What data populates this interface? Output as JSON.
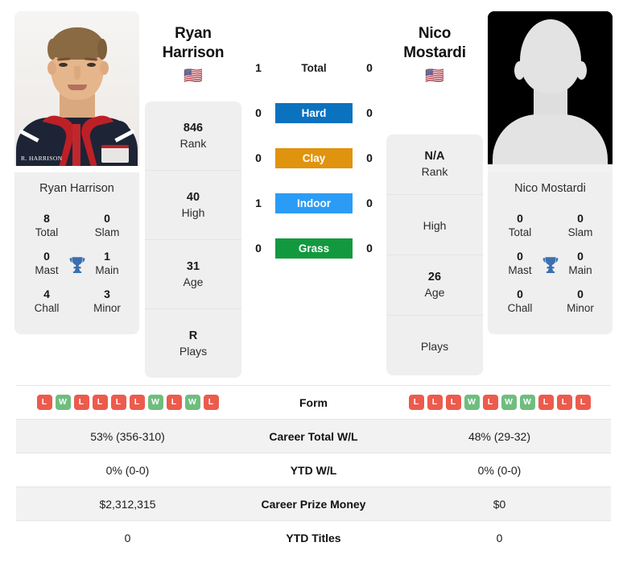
{
  "players": {
    "left": {
      "first_name": "Ryan",
      "last_name": "Harrison",
      "full_name": "Ryan Harrison",
      "flag": "🇺🇸",
      "flag_name": "usa-flag",
      "photo_jacket_text": "R. HARRISON",
      "info": [
        {
          "value": "846",
          "label": "Rank"
        },
        {
          "value": "40",
          "label": "High"
        },
        {
          "value": "31",
          "label": "Age"
        },
        {
          "value": "R",
          "label": "Plays"
        }
      ],
      "titles": [
        {
          "value": "8",
          "label": "Total"
        },
        {
          "value": "0",
          "label": "Slam"
        },
        {
          "value": "0",
          "label": "Mast"
        },
        {
          "value": "1",
          "label": "Main"
        },
        {
          "value": "4",
          "label": "Chall"
        },
        {
          "value": "3",
          "label": "Minor"
        }
      ],
      "form": [
        "L",
        "W",
        "L",
        "L",
        "L",
        "L",
        "W",
        "L",
        "W",
        "L"
      ],
      "career_total_wl": "53% (356-310)",
      "ytd_wl": "0% (0-0)",
      "career_prize_money": "$2,312,315",
      "ytd_titles": "0"
    },
    "right": {
      "first_name": "Nico",
      "last_name": "Mostardi",
      "full_name": "Nico Mostardi",
      "flag": "🇺🇸",
      "flag_name": "usa-flag",
      "info": [
        {
          "value": "N/A",
          "label": "Rank"
        },
        {
          "value": "",
          "label": "High"
        },
        {
          "value": "26",
          "label": "Age"
        },
        {
          "value": "",
          "label": "Plays"
        }
      ],
      "titles": [
        {
          "value": "0",
          "label": "Total"
        },
        {
          "value": "0",
          "label": "Slam"
        },
        {
          "value": "0",
          "label": "Mast"
        },
        {
          "value": "0",
          "label": "Main"
        },
        {
          "value": "0",
          "label": "Chall"
        },
        {
          "value": "0",
          "label": "Minor"
        }
      ],
      "form": [
        "L",
        "L",
        "L",
        "W",
        "L",
        "W",
        "W",
        "L",
        "L",
        "L"
      ],
      "career_total_wl": "48% (29-32)",
      "ytd_wl": "0% (0-0)",
      "career_prize_money": "$0",
      "ytd_titles": "0"
    }
  },
  "surfaces": [
    {
      "label": "Total",
      "left": "1",
      "right": "0",
      "style": "plain",
      "color": ""
    },
    {
      "label": "Hard",
      "left": "0",
      "right": "0",
      "style": "hard",
      "color": "#0b72bf"
    },
    {
      "label": "Clay",
      "left": "0",
      "right": "0",
      "style": "clay",
      "color": "#e0930d"
    },
    {
      "label": "Indoor",
      "left": "1",
      "right": "0",
      "style": "indoor",
      "color": "#2b9cf5"
    },
    {
      "label": "Grass",
      "left": "0",
      "right": "0",
      "style": "grass",
      "color": "#12993f"
    }
  ],
  "table_rows": [
    {
      "label": "Form",
      "type": "form",
      "left": "",
      "right": ""
    },
    {
      "label": "Career Total W/L",
      "type": "text",
      "left": "53% (356-310)",
      "right": "48% (29-32)"
    },
    {
      "label": "YTD W/L",
      "type": "text",
      "left": "0% (0-0)",
      "right": "0% (0-0)"
    },
    {
      "label": "Career Prize Money",
      "type": "text",
      "left": "$2,312,315",
      "right": "$0"
    },
    {
      "label": "YTD Titles",
      "type": "text",
      "left": "0",
      "right": "0"
    }
  ],
  "colors": {
    "win_badge": "#6fbd7f",
    "loss_badge": "#ec5b4d",
    "card_bg": "#efefef",
    "trophy": "#3b6fb0",
    "row_shaded": "#f2f2f2"
  }
}
